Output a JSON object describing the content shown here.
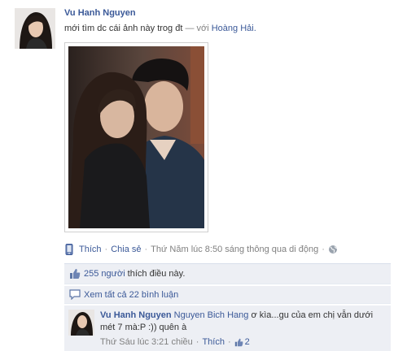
{
  "post": {
    "author": "Vu Hanh Nguyen",
    "message": "mới tìm dc cái ảnh này trog đt",
    "with_prefix": "— với",
    "tagged": "Hoàng Hải."
  },
  "actions": {
    "like": "Thích",
    "share": "Chia sẻ",
    "sep": "·",
    "timestamp": "Thứ Năm lúc 8:50 sáng thông qua di động"
  },
  "likes": {
    "link": "255 người",
    "text": "thích điều này."
  },
  "view_all": "Xem tất cả 22 bình luận",
  "comment": {
    "author": "Vu Hanh Nguyen",
    "mention": "Nguyen Bich Hang",
    "text": "ơ kìa...gu của em chị vẫn dưới mét 7 mà:P :)) quên à",
    "timestamp": "Thứ Sáu lúc 3:21 chiều",
    "like": "Thích",
    "like_count": "2"
  },
  "colors": {
    "link": "#3b5998",
    "ufi_bg": "#edeff4",
    "muted": "#808080"
  },
  "icons": {
    "mobile": "mobile-phone-icon",
    "globe": "globe-icon",
    "thumbs_up": "thumbs-up-icon",
    "comment": "comment-bubble-icon"
  }
}
